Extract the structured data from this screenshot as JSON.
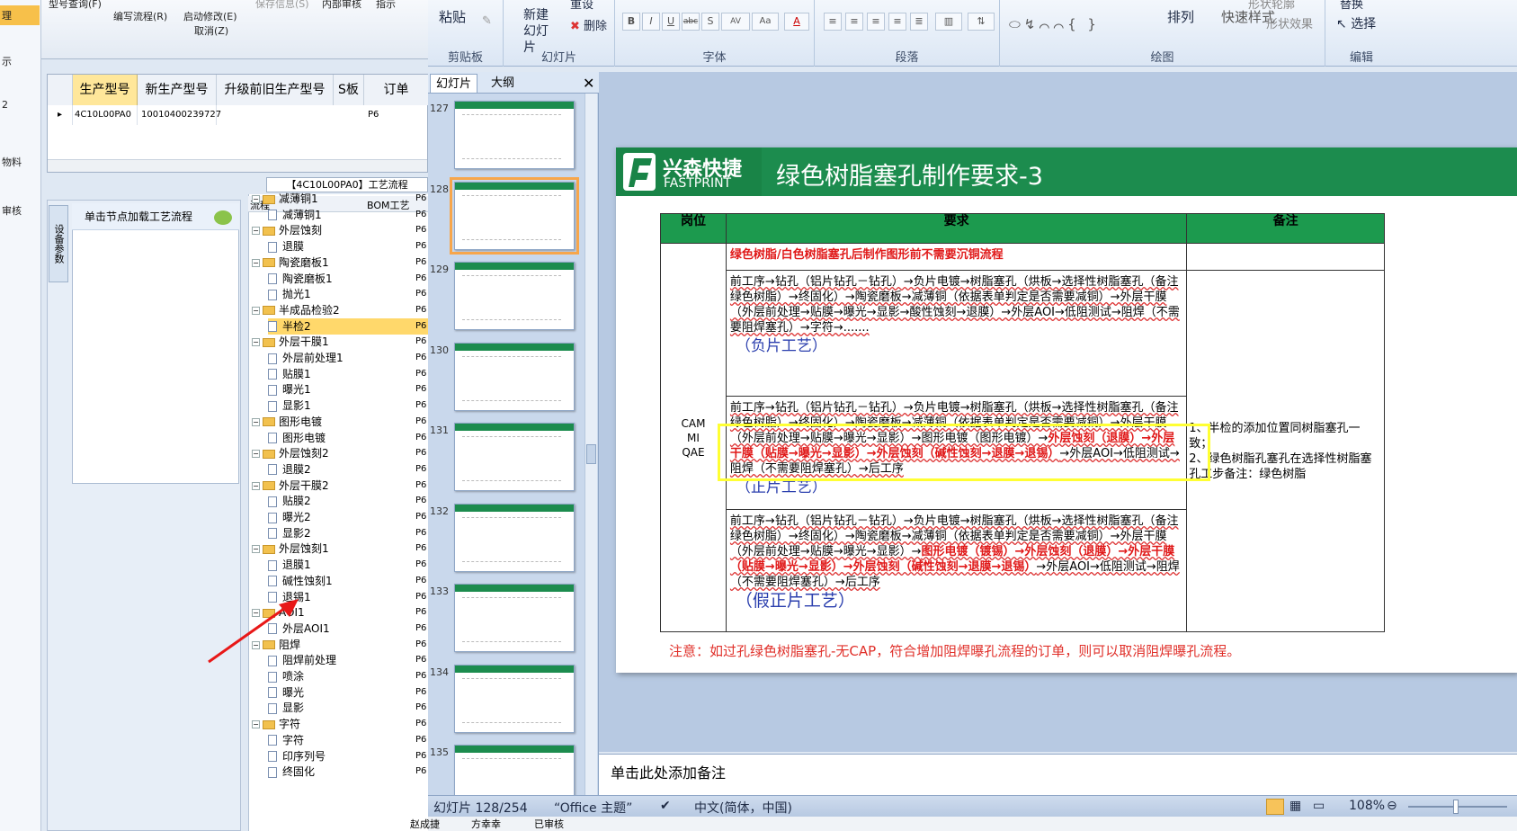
{
  "erp": {
    "left_labels": [
      "理",
      "示",
      "2",
      "物料",
      "审核"
    ],
    "toolbar": [
      "型号查询(F)",
      "编写流程(R)",
      "启动修改(E)",
      "取消(Z)",
      "保存信息(S)",
      "内部审核",
      "指示"
    ],
    "grid": {
      "headers": [
        "生产型号",
        "新生产型号",
        "升级前旧生产型号",
        "S板",
        "订单"
      ],
      "row": [
        "4C10L00PA0",
        "10010400239727",
        "",
        "",
        "P6"
      ]
    },
    "flow_caption": "【4C10L00PA0】工艺流程",
    "side_tab": "设备参数",
    "node_hint": "单击节点加载工艺流程",
    "tree_headers": [
      "流程",
      "BOM工艺"
    ],
    "tree": [
      {
        "label": "减薄铜1",
        "type": "folder",
        "val": "P6"
      },
      {
        "label": "减薄铜1",
        "type": "doc",
        "val": "P6"
      },
      {
        "label": "外层蚀刻",
        "type": "folder",
        "val": "P6"
      },
      {
        "label": "退膜",
        "type": "doc",
        "val": "P6"
      },
      {
        "label": "陶瓷磨板1",
        "type": "folder",
        "val": "P6"
      },
      {
        "label": "陶瓷磨板1",
        "type": "doc",
        "val": "P6"
      },
      {
        "label": "抛光1",
        "type": "doc",
        "val": "P6"
      },
      {
        "label": "半成品检验2",
        "type": "folder",
        "val": "P6"
      },
      {
        "label": "半检2",
        "type": "doc",
        "val": "P6",
        "sel": true
      },
      {
        "label": "外层干膜1",
        "type": "folder",
        "val": "P6"
      },
      {
        "label": "外层前处理1",
        "type": "doc",
        "val": "P6"
      },
      {
        "label": "贴膜1",
        "type": "doc",
        "val": "P6"
      },
      {
        "label": "曝光1",
        "type": "doc",
        "val": "P6"
      },
      {
        "label": "显影1",
        "type": "doc",
        "val": "P6"
      },
      {
        "label": "图形电镀",
        "type": "folder",
        "val": "P6"
      },
      {
        "label": "图形电镀",
        "type": "doc",
        "val": "P6"
      },
      {
        "label": "外层蚀刻2",
        "type": "folder",
        "val": "P6"
      },
      {
        "label": "退膜2",
        "type": "doc",
        "val": "P6"
      },
      {
        "label": "外层干膜2",
        "type": "folder",
        "val": "P6"
      },
      {
        "label": "贴膜2",
        "type": "doc",
        "val": "P6"
      },
      {
        "label": "曝光2",
        "type": "doc",
        "val": "P6"
      },
      {
        "label": "显影2",
        "type": "doc",
        "val": "P6"
      },
      {
        "label": "外层蚀刻1",
        "type": "folder",
        "val": "P6"
      },
      {
        "label": "退膜1",
        "type": "doc",
        "val": "P6"
      },
      {
        "label": "碱性蚀刻1",
        "type": "doc",
        "val": "P6"
      },
      {
        "label": "退锡1",
        "type": "doc",
        "val": "P6"
      },
      {
        "label": "AOI1",
        "type": "folder",
        "val": "P6"
      },
      {
        "label": "外层AOI1",
        "type": "doc",
        "val": "P6"
      },
      {
        "label": "阻焊",
        "type": "folder",
        "val": "P6"
      },
      {
        "label": "阻焊前处理",
        "type": "doc",
        "val": "P6"
      },
      {
        "label": "喷涂",
        "type": "doc",
        "val": "P6"
      },
      {
        "label": "曝光",
        "type": "doc",
        "val": "P6"
      },
      {
        "label": "显影",
        "type": "doc",
        "val": "P6"
      },
      {
        "label": "字符",
        "type": "folder",
        "val": "P6"
      },
      {
        "label": "字符",
        "type": "doc",
        "val": "P6"
      },
      {
        "label": "印序列号",
        "type": "doc",
        "val": "P6"
      },
      {
        "label": "终固化",
        "type": "doc",
        "val": "P6"
      }
    ]
  },
  "ribbon": {
    "groups": [
      "剪贴板",
      "幻灯片",
      "字体",
      "段落",
      "绘图",
      "编辑"
    ],
    "paste": "粘贴",
    "new_slide": "新建幻灯片",
    "reset": "重设",
    "delete": "删除",
    "arrange": "排列",
    "quick_styles": "快速样式",
    "shape_outline": "形状轮廓",
    "shape_effects": "形状效果",
    "replace": "替换",
    "select": "选择"
  },
  "pane": {
    "tabs": [
      "幻灯片",
      "大纲"
    ],
    "thumbs": [
      "127",
      "128",
      "129",
      "130",
      "131",
      "132",
      "133",
      "134",
      "135"
    ],
    "selected": "128"
  },
  "slide": {
    "logo_cn": "兴森快捷",
    "logo_en": "FASTPRINT",
    "title": "绿色树脂塞孔制作要求-3",
    "headers": [
      "岗位",
      "要求",
      "备注"
    ],
    "role": [
      "CAM",
      "MI",
      "QAE"
    ],
    "red_line": "绿色树脂/白色树脂塞孔后制作图形前不需要沉铜流程",
    "proc1": "前工序→钻孔（铝片钻孔－钻孔）→负片电镀→树脂塞孔（烘板→选择性树脂塞孔（备注绿色树脂）→终固化）→陶瓷磨板→减薄铜（依据表单判定是否需要减铜）→外层干膜（外层前处理→贴膜→曝光→显影→酸性蚀刻→退膜）→外层AOI→低阻测试→阻焊（不需要阻焊塞孔）→字符→.......",
    "tag1": "（负片工艺）",
    "proc2a": "前工序→钻孔（铝片钻孔－钻孔）→负片电镀→树脂塞孔（烘板→选择性树脂塞孔（备注绿色树脂）→终固化）→陶瓷磨板→减薄铜（依据表单判定是否需要减铜）→外层干膜（外层前处理→贴膜→曝光→显影）→图形电镀（图形电镀）→",
    "proc2b": "外层蚀刻（退膜）→外层干膜（贴膜→曝光→显影）→外层蚀刻（碱性蚀刻→退膜→退锡）",
    "proc2c": "→外层AOI→低阻测试→阻焊（不需要阻焊塞孔）→后工序",
    "tag2": "（正片工艺）",
    "proc3a": "前工序→钻孔（铝片钻孔－钻孔）→负片电镀→树脂塞孔（烘板→选择性树脂塞孔（备注绿色树脂）→终固化）→陶瓷磨板→减薄铜（依据表单判定是否需要减铜）→外层干膜（外层前处理→贴膜→曝光→显影）→",
    "proc3b": "图形电镀（镀锡）→外层蚀刻（退膜）→外层干膜（贴膜→曝光→显影）→外层蚀刻（碱性蚀刻→退膜→退锡）",
    "proc3c": "→外层AOI→低阻测试→阻焊（不需要阻焊塞孔）→后工序",
    "tag3": "（假正片工艺）",
    "remark1": "1、半检的添加位置同树脂塞孔一致；",
    "remark2": "2、绿色树脂孔塞孔在选择性树脂塞孔工步备注：绿色树脂",
    "note": "注意：如过孔绿色树脂塞孔-无CAP，符合增加阻焊曝孔流程的订单，则可以取消阻焊曝孔流程。"
  },
  "notes_placeholder": "单击此处添加备注",
  "status": {
    "slide_pos": "幻灯片 128/254",
    "theme": "“Office 主题”",
    "lang": "中文(简体，中国)",
    "zoom": "108%"
  },
  "bottom_text": [
    "赵成捷",
    "方幸幸",
    "已审核"
  ]
}
